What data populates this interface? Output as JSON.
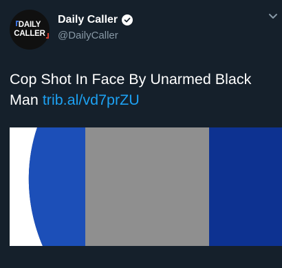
{
  "account": {
    "avatar_line1": "DAILY",
    "avatar_line2": "CALLER",
    "display_name": "Daily Caller",
    "handle": "@DailyCaller",
    "verified": true
  },
  "tweet": {
    "text": "Cop Shot In Face By Unarmed Black Man",
    "link": "trib.al/vd7prZU"
  },
  "media": {
    "background_colors": [
      "#ffffff",
      "#1c4fb8",
      "#0b2c7a"
    ]
  },
  "colors": {
    "background": "#15202b",
    "link": "#1da1f2",
    "secondary_text": "#8899a6"
  }
}
